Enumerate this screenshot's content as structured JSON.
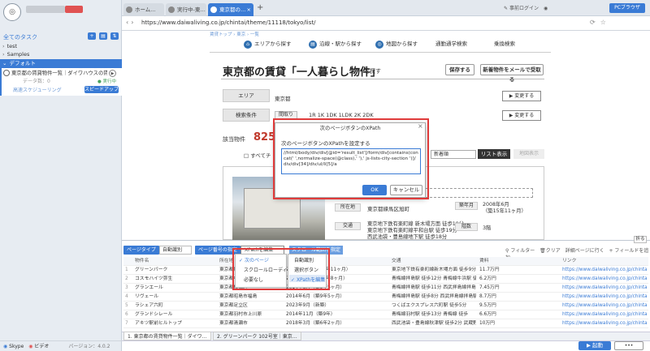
{
  "left": {
    "logo_icon": "octopus-logo",
    "mail": "",
    "all_tasks": "全てのタスク",
    "tree": [
      {
        "label": "test"
      },
      {
        "label": "Samples"
      },
      {
        "label": "デフォルト"
      }
    ],
    "task": {
      "title": "東京都の賃貸物件一覧｜ダイワハウスの賃貸…",
      "data": "データ数：0",
      "status": "● 実行中",
      "schedule": "高速スケジューリング",
      "speedup": "スピードアップ"
    },
    "footer": {
      "skype": "Skype",
      "video": "ビデオ",
      "version": "バージョン：4.0.2"
    }
  },
  "browser": {
    "tabs": [
      {
        "label": "ホーム…"
      },
      {
        "label": "実行中-東…"
      },
      {
        "label": "東京都の…"
      }
    ],
    "login": "事前ログイン",
    "pc_browse": "PCブラウザ",
    "url": "https://www.daiwaliving.co.jp/chintai/theme/11118/tokyo/list/"
  },
  "page": {
    "breadcrumb": "賃貸トップ › 東京 › 一覧",
    "nav": [
      "エリアから探す",
      "沿線・駅から探す",
      "地図から探す",
      "通勤通学検索",
      "乗換検索"
    ],
    "title": "東京都の賃貸「一人暮らし物件」",
    "title_suffix": "を探す",
    "save": "保存する",
    "mail": "新着物件をメールで受取る",
    "area_label": "エリア",
    "area_value": "東京都",
    "cond_label": "検索条件",
    "cond_chip": "間取り",
    "cond_value": "1R 1K 1DK 1LDK 2K 2DK",
    "change": "▶ 変更する",
    "count_label": "該当物件",
    "count": "825",
    "count_suffix": "件",
    "check_all": "□ すべてチ",
    "sort": "新着順",
    "list_view": "リスト表示",
    "map_view": "地図表示",
    "card": {
      "addr_label": "所在地",
      "addr": "東京都練馬区旭町",
      "station_label": "交通",
      "stations": [
        "東京地下鉄有楽町線 新木場方面 徒歩19分",
        "東京地下鉄有楽町線平和台駅 徒歩19分",
        "西武池袋・豊島線地下駅 徒歩18分"
      ],
      "year_label": "築年月",
      "year": "2008年6月\n（築15年11ヶ月）",
      "floor_label": "階数",
      "floor": "3階"
    }
  },
  "dialog": {
    "title": "次のページボタンのXPath",
    "close": "×",
    "label": "次のページボタンのXPathを設定する",
    "xpath": "//html/body/div/div[@id='result_list']/form/div[contains(concat(' ',normalize-space(@class),' '),' js-lists-city-section ')]/div/div[34]/div/ul/li[5]/a",
    "ok": "OK",
    "cancel": "キャンセル"
  },
  "panel": {
    "collapse": "折る",
    "page_type": "ページタイプ",
    "page_type_val": "自動識別",
    "next_btn": "ページ番号の指定",
    "xpath_edit": "XPathを編集",
    "scroll_range": "スクロール範囲を指定",
    "filter": "フィルター",
    "clear": "クリア",
    "detail": "詳細ページに行く",
    "add_field": "+ フィールドを追加",
    "menu1": [
      "次のページ",
      "スクロールローディング",
      "必要なし"
    ],
    "menu2": [
      "自動識別",
      "選択ボタン",
      "XPathを編集"
    ],
    "columns": [
      "物件名",
      "所在地",
      "築年",
      "",
      "交通",
      "",
      "賃料",
      "リンク"
    ],
    "rows": [
      [
        "グリーンパーク",
        "東京都練馬区旭町",
        "2008年6月（築15年11ヶ月）",
        "東京地下鉄有楽町線新木場方面 徒歩9分",
        "11.7万円",
        "https://www.daiwaliving.co.jp/chintai/70001"
      ],
      [
        "コスモハイツ弥生",
        "東京都中野区",
        "2006年3月（築17年8ヶ月）",
        "青梅線拝島駅 徒歩12分 青梅線牛浜駅 徒歩",
        "6.2万円",
        "https://www.daiwaliving.co.jp/chintai/70002"
      ],
      [
        "グランエール",
        "東京都板橋区",
        "2014年6月（築9年5ヶ月）",
        "青梅線拝島駅 徒歩11分 西武拝島線拝島駅",
        "7.45万円",
        "https://www.daiwaliving.co.jp/chintai/70003"
      ],
      [
        "リヴェール",
        "東京都昭島市福島",
        "2014年6月（築9年5ヶ月）",
        "青梅線拝島駅 徒歩8分 西武拝島線拝島駅 ",
        "8.7万円",
        "https://www.daiwaliving.co.jp/chintai/70004"
      ],
      [
        "ラシェア六町",
        "東京都足立区",
        "2023年9月（新築）",
        "つくばエクスプレス六町駅 徒歩5分 ",
        "9.5万円",
        "https://www.daiwaliving.co.jp/chintai/70005"
      ],
      [
        "グランドシレール",
        "東京都羽村市上川原",
        "2014年11月（築9年）",
        "青梅線羽村駅 徒歩13分 青梅線 徒歩",
        "6.6万円",
        "https://www.daiwaliving.co.jp/chintai/70006"
      ],
      [
        "アキツ駅前ヒルトップ",
        "東京都清瀬市",
        "2018年3月（築6年2ヶ月）",
        "西武池袋・豊島線秋津駅 徒歩2分 武蔵野線",
        "10万円",
        "https://www.daiwaliving.co.jp/chintai/70007"
      ]
    ],
    "bottom_tabs": [
      "1. 東京都の賃貸物件一覧｜ダイワ…",
      "2. グリーンパーク 102号室｜東京…"
    ],
    "start": "▶ 起動",
    "more": "••• "
  }
}
